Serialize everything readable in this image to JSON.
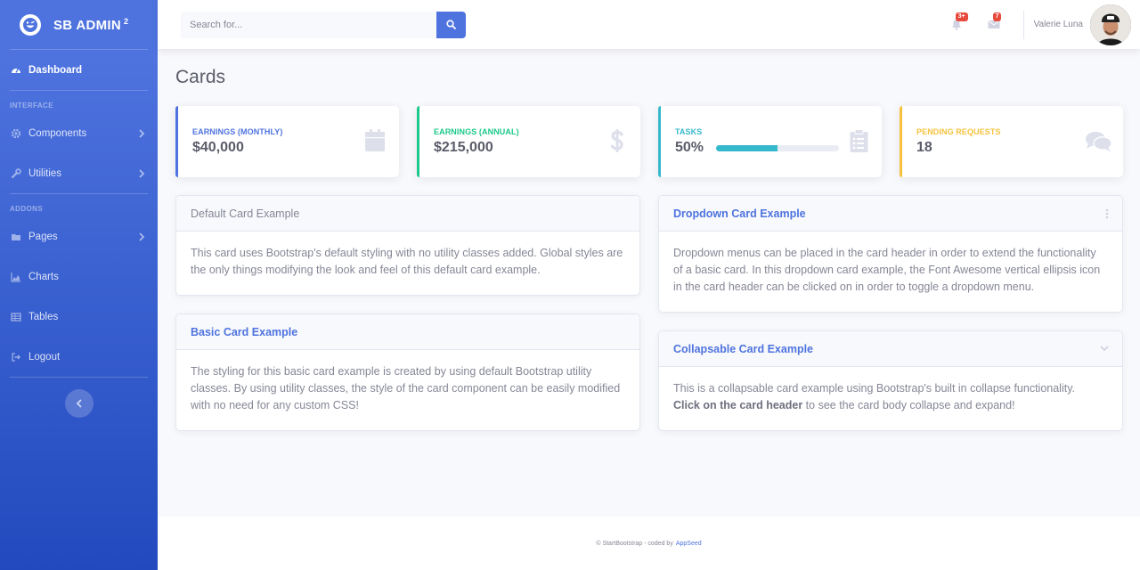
{
  "brand": {
    "name": "SB Admin",
    "sup": "2"
  },
  "sidebar": {
    "items": [
      {
        "label": "Dashboard"
      },
      {
        "label": "Components"
      },
      {
        "label": "Utilities"
      },
      {
        "label": "Pages"
      },
      {
        "label": "Charts"
      },
      {
        "label": "Tables"
      },
      {
        "label": "Logout"
      }
    ],
    "headings": {
      "interface": "Interface",
      "addons": "Addons"
    }
  },
  "topbar": {
    "search_placeholder": "Search for...",
    "alerts_badge": "3+",
    "messages_badge": "7",
    "user_name": "Valerie Luna"
  },
  "page": {
    "title": "Cards"
  },
  "stats": [
    {
      "label": "Earnings (Monthly)",
      "value": "$40,000",
      "color": "#4e73df",
      "icon": "calendar-icon"
    },
    {
      "label": "Earnings (Annual)",
      "value": "$215,000",
      "color": "#1cc88a",
      "icon": "dollar-icon"
    },
    {
      "label": "Tasks",
      "value": "50%",
      "progress": 0.5,
      "color": "#36b9cc",
      "icon": "clipboard-list-icon"
    },
    {
      "label": "Pending Requests",
      "value": "18",
      "color": "#f6c23e",
      "icon": "comments-icon"
    }
  ],
  "cards": {
    "default": {
      "title": "Default Card Example",
      "body": "This card uses Bootstrap's default styling with no utility classes added. Global styles are the only things modifying the look and feel of this default card example."
    },
    "basic": {
      "title": "Basic Card Example",
      "body": "The styling for this basic card example is created by using default Bootstrap utility classes. By using utility classes, the style of the card component can be easily modified with no need for any custom CSS!"
    },
    "dropdown": {
      "title": "Dropdown Card Example",
      "body": "Dropdown menus can be placed in the card header in order to extend the functionality of a basic card. In this dropdown card example, the Font Awesome vertical ellipsis icon in the card header can be clicked on in order to toggle a dropdown menu."
    },
    "collapsable": {
      "title": "Collapsable Card Example",
      "body_pre": "This is a collapsable card example using Bootstrap's built in collapse functionality.",
      "body_bold": "Click on the card header",
      "body_post": "to see the card body collapse and expand!"
    }
  },
  "footer": {
    "text": "© StartBootstrap - coded by",
    "link": "AppSeed"
  }
}
